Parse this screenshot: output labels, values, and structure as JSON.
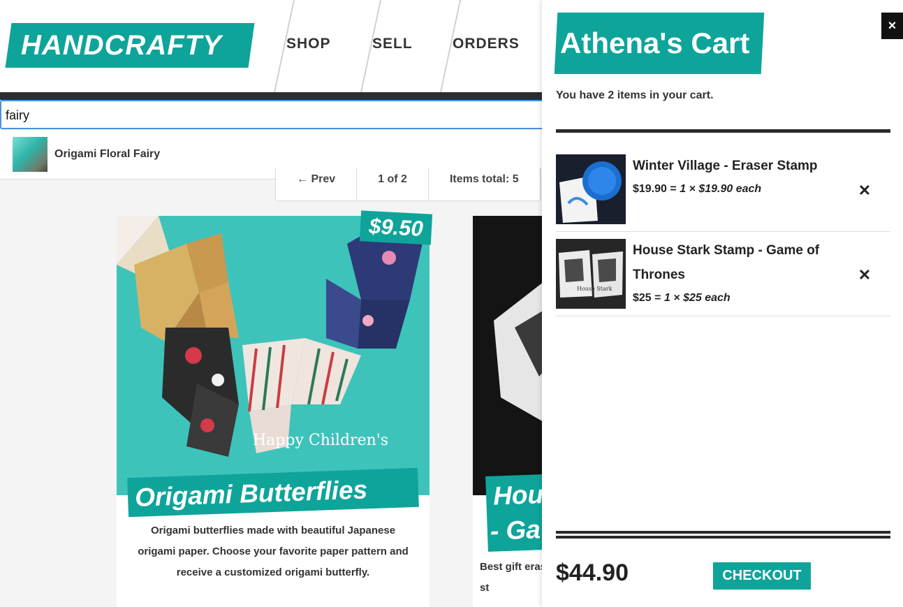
{
  "header": {
    "logo": "HANDCRAFTY",
    "nav": [
      "SHOP",
      "SELL",
      "ORDERS"
    ]
  },
  "search": {
    "value": "fairy",
    "suggestion": "Origami Floral Fairy"
  },
  "pagination": {
    "prev": "← Prev",
    "page": "1 of 2",
    "total": "Items total: 5"
  },
  "products": [
    {
      "title": "Origami Butterflies",
      "price": "$9.50",
      "description": "Origami butterflies made with beautiful Japanese origami paper. Choose your favorite paper pattern and receive a customized origami butterfly.",
      "image_text": "Happy Children's"
    },
    {
      "title_line1": "Hou",
      "title_line2": "- Ga",
      "description": "Best gift eraser st"
    }
  ],
  "cart": {
    "title": "Athena's Cart",
    "close_label": "×",
    "count_text": "You have 2 items in your cart.",
    "items": [
      {
        "name": "Winter Village - Eraser Stamp",
        "subtotal": "$19.90 =",
        "detail": "1 × $19.90 each",
        "remove_label": "✕"
      },
      {
        "name": "House Stark Stamp - Game of Thrones",
        "subtotal": "$25 =",
        "detail": "1 × $25 each",
        "remove_label": "✕",
        "image_text": "House Stark"
      }
    ],
    "total": "$44.90",
    "checkout_label": "CHECKOUT"
  },
  "colors": {
    "brand": "#0ea49a",
    "dark": "#2e2e2e",
    "focus": "#4d90e0"
  }
}
